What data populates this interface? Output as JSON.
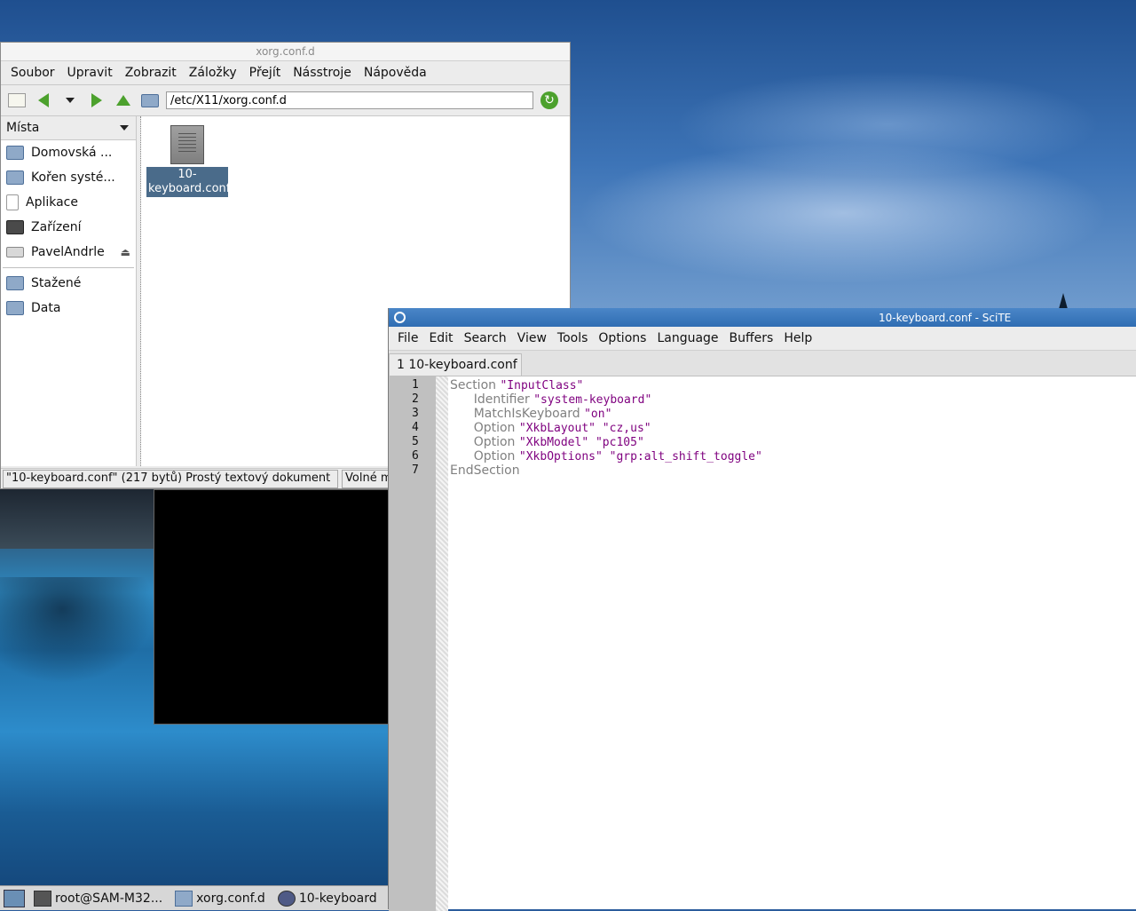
{
  "file_manager": {
    "title": "xorg.conf.d",
    "menu": [
      "Soubor",
      "Upravit",
      "Zobrazit",
      "Záložky",
      "Přejít",
      "Násstroje",
      "Nápověda"
    ],
    "location": "/etc/X11/xorg.conf.d",
    "sidebar_header": "Místa",
    "places": [
      "Domovská ...",
      "Kořen systé...",
      "Aplikace",
      "Zařízení",
      "PavelAndrle"
    ],
    "bookmarks": [
      "Stažené",
      "Data"
    ],
    "file": {
      "name": "10-keyboard.conf",
      "label": "10-\nkeyboard.conf"
    },
    "status": "\"10-keyboard.conf\" (217 bytů) Prostý textový dokument",
    "status_free": "Volné mí"
  },
  "taskbar": {
    "tasks": [
      "root@SAM-M32...",
      "xorg.conf.d",
      "10-keyboard"
    ]
  },
  "scite": {
    "title": "10-keyboard.conf - SciTE",
    "menu": [
      "File",
      "Edit",
      "Search",
      "View",
      "Tools",
      "Options",
      "Language",
      "Buffers",
      "Help"
    ],
    "tab": "1 10-keyboard.conf",
    "lines": [
      {
        "n": "1",
        "indent": "",
        "kw": "Section",
        "strs": "\"InputClass\""
      },
      {
        "n": "2",
        "indent": "      ",
        "kw": "Identifier",
        "strs": "\"system-keyboard\""
      },
      {
        "n": "3",
        "indent": "      ",
        "kw": "MatchIsKeyboard",
        "strs": "\"on\""
      },
      {
        "n": "4",
        "indent": "      ",
        "kw": "Option",
        "strs": "\"XkbLayout\" \"cz,us\""
      },
      {
        "n": "5",
        "indent": "      ",
        "kw": "Option",
        "strs": "\"XkbModel\" \"pc105\""
      },
      {
        "n": "6",
        "indent": "      ",
        "kw": "Option",
        "strs": "\"XkbOptions\" \"grp:alt_shift_toggle\""
      },
      {
        "n": "7",
        "indent": "",
        "kw": "EndSection",
        "strs": ""
      }
    ]
  }
}
